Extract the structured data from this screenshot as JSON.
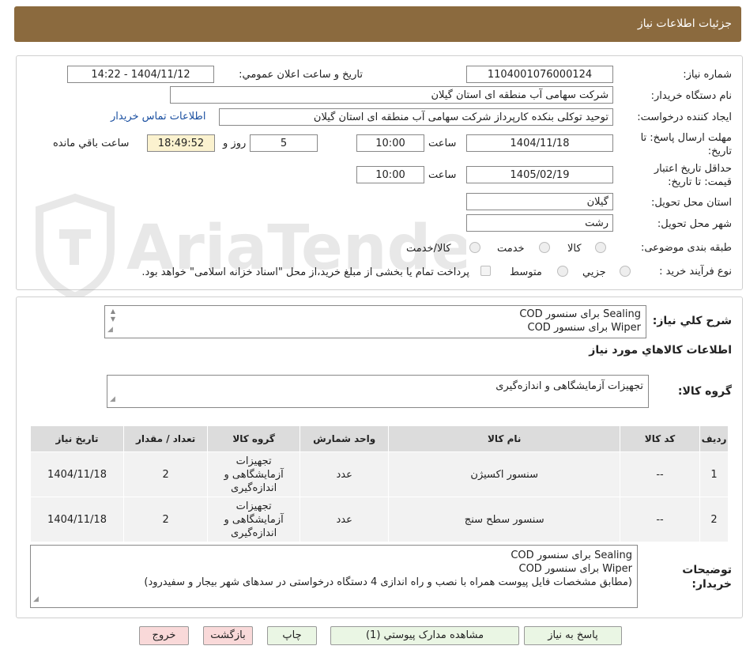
{
  "header": {
    "title": "جزئیات اطلاعات نیاز"
  },
  "info": {
    "need_number_label": "شماره نیاز:",
    "need_number": "1104001076000124",
    "announce_label": "تاریخ و ساعت اعلان عمومي:",
    "announce_value": "1404/11/12 - 14:22",
    "buyer_label": "نام دستگاه خریدار:",
    "buyer_value": "شرکت سهامی آب منطقه ای استان گیلان",
    "creator_label": "ایجاد کننده درخواست:",
    "creator_value": "توحید توکلی بنکده کارپرداز شرکت سهامی آب منطقه ای استان گیلان",
    "contact_link": "اطلاعات تماس خریدار",
    "deadline_label": "مهلت ارسال پاسخ: تا تاریخ:",
    "deadline_date": "1404/11/18",
    "time_label": "ساعت",
    "deadline_time": "10:00",
    "days_value": "5",
    "days_label": "روز و",
    "remaining_value": "18:49:52",
    "remaining_label": "ساعت باقي مانده",
    "validity_label": "حداقل تاریخ اعتبار قیمت: تا تاریخ:",
    "validity_date": "1405/02/19",
    "validity_time": "10:00",
    "province_label": "استان محل تحویل:",
    "province_value": "گیلان",
    "city_label": "شهر محل تحویل:",
    "city_value": "رشت",
    "category_label": "طبقه بندی موضوعی:",
    "category_options": [
      "کالا",
      "خدمت",
      "کالا/خدمت"
    ],
    "process_label": "نوع فرآیند خرید :",
    "process_options": [
      "جزیي",
      "متوسط"
    ],
    "payment_note": "پرداخت تمام یا بخشی از مبلغ خرید،از محل \"اسناد خزانه اسلامی\" خواهد بود."
  },
  "watermark": {
    "text": "AriaTender.net"
  },
  "description": {
    "label": "شرح کلي نیاز:",
    "lines": [
      "Sealing برای سنسور COD",
      "Wiper  برای سنسور COD"
    ]
  },
  "goods": {
    "section_title": "اطلاعات کالاهاي مورد نیاز",
    "group_label": "گروه کالا:",
    "group_value": "تجهیزات آزمایشگاهی و اندازه‌گیری",
    "columns": [
      "ردیف",
      "کد کالا",
      "نام کالا",
      "واحد شمارش",
      "گروه کالا",
      "تعداد / مقدار",
      "تاریخ نیاز"
    ],
    "rows": [
      {
        "index": "1",
        "code": "--",
        "name": "سنسور اکسیژن",
        "unit": "عدد",
        "group_lines": [
          "تجهیزات",
          "آزمایشگاهی و",
          "اندازه‌گیری"
        ],
        "qty": "2",
        "date": "1404/11/18"
      },
      {
        "index": "2",
        "code": "--",
        "name": "سنسور سطح سنج",
        "unit": "عدد",
        "group_lines": [
          "تجهیزات",
          "آزمایشگاهی و",
          "اندازه‌گیری"
        ],
        "qty": "2",
        "date": "1404/11/18"
      }
    ]
  },
  "buyer_notes": {
    "label_line1": "توضیحات",
    "label_line2": "خریدار:",
    "lines": [
      "Sealing برای سنسور COD",
      "Wiper  برای سنسور COD",
      "(مطابق مشخصات فایل پیوست همراه با نصب و راه اندازی 4 دستگاه درخواستی در سدهای شهر بیجار و سفیدرود)"
    ]
  },
  "buttons": {
    "reply": "پاسخ به نیاز",
    "attachments": "مشاهده مدارک پیوستي (1)",
    "print": "چاپ",
    "back": "بازگشت",
    "exit": "خروج"
  }
}
